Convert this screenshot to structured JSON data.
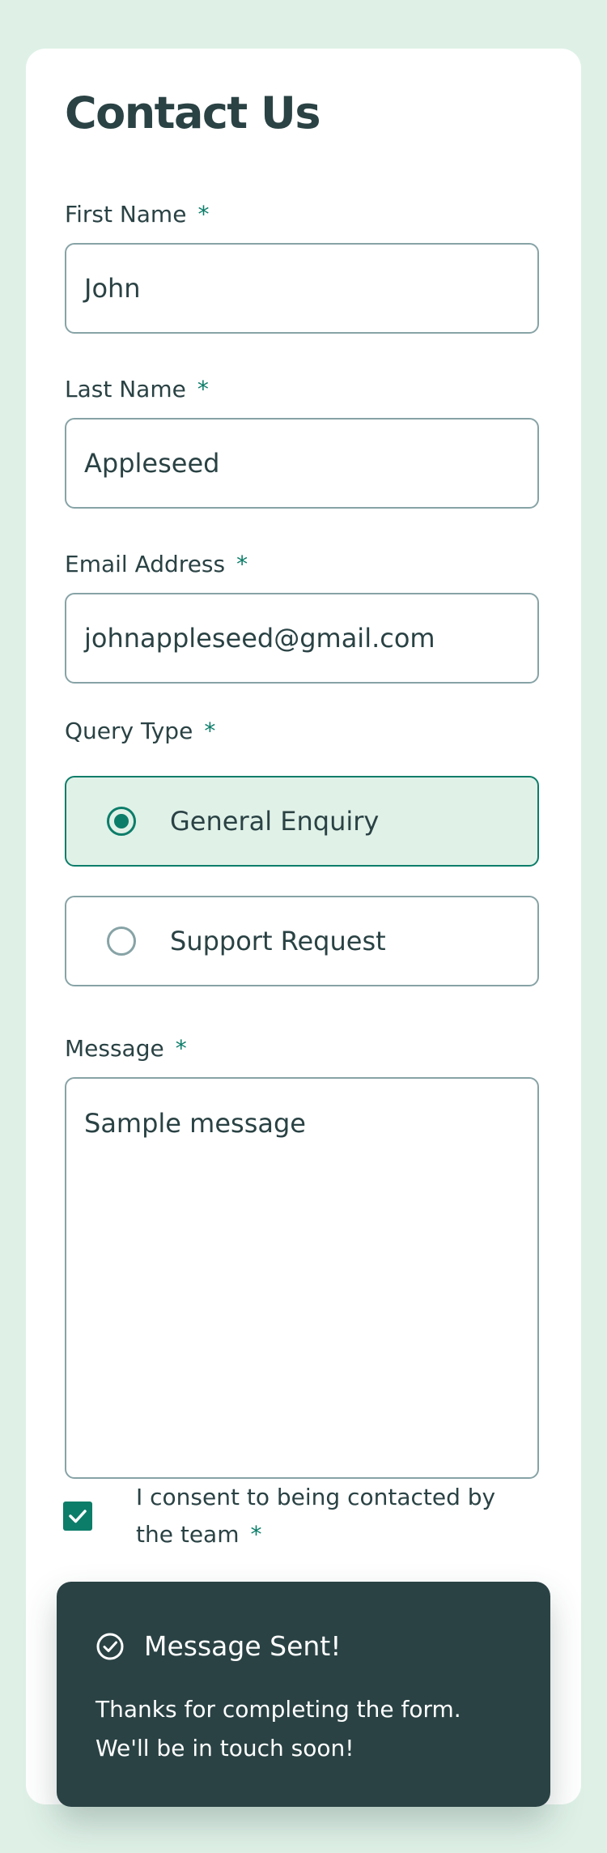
{
  "form": {
    "title": "Contact Us",
    "required_marker": "*",
    "first_name": {
      "label": "First Name",
      "value": "John"
    },
    "last_name": {
      "label": "Last Name",
      "value": "Appleseed"
    },
    "email": {
      "label": "Email Address",
      "value": "johnappleseed@gmail.com"
    },
    "query_type": {
      "label": "Query Type",
      "options": [
        {
          "label": "General Enquiry",
          "selected": true
        },
        {
          "label": "Support Request",
          "selected": false
        }
      ]
    },
    "message": {
      "label": "Message",
      "value": "Sample message"
    },
    "consent": {
      "label": "I consent to being contacted by the team",
      "checked": true
    }
  },
  "toast": {
    "icon": "check-circle-icon",
    "title": "Message Sent!",
    "body": "Thanks for completing the form. We'll be in touch soon!"
  },
  "colors": {
    "page_background": "#dff1e7",
    "card": "#ffffff",
    "accent": "#0c7d69",
    "text": "#2a4244",
    "border": "#87a3a6",
    "selected_background": "#e0f1e8",
    "toast_background": "#2a4244"
  }
}
